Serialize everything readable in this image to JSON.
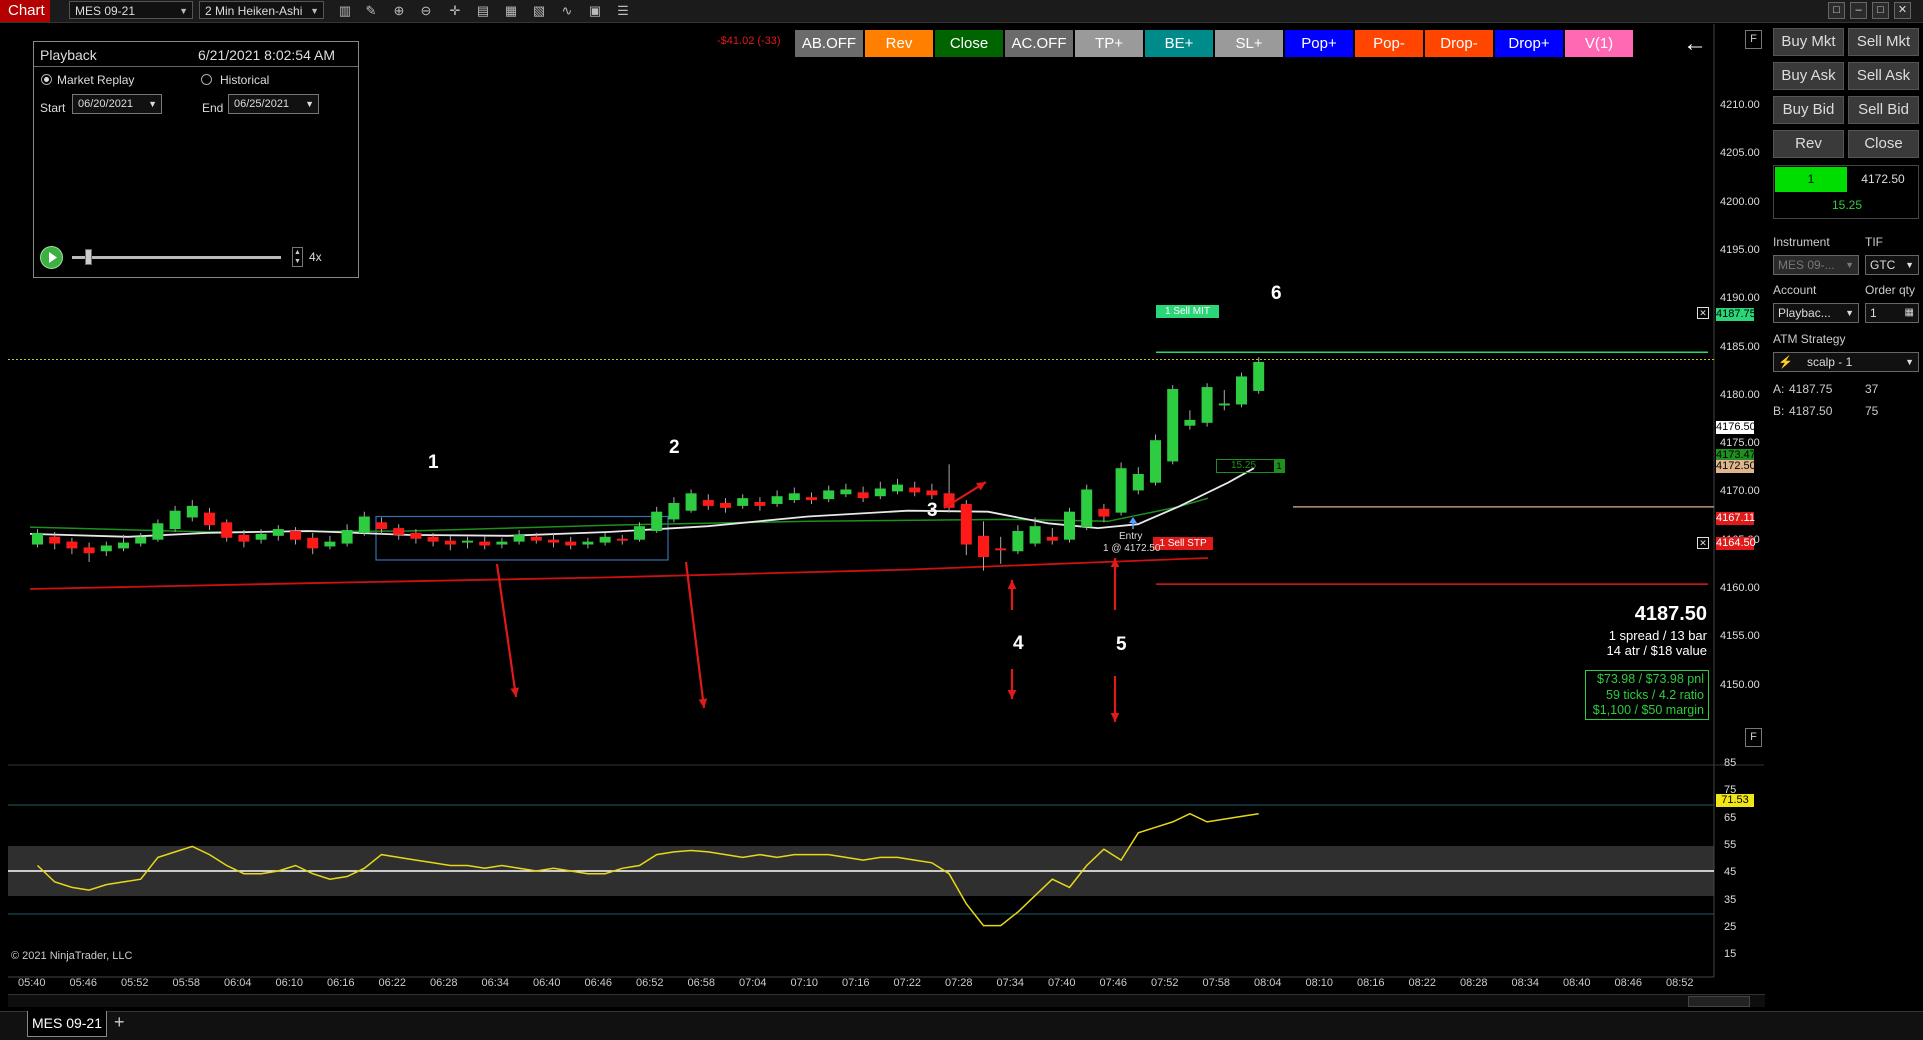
{
  "toolbar": {
    "chart_tab": "Chart",
    "instrument": "MES 09-21",
    "interval": "2 Min Heiken-Ashi",
    "icons": [
      "bars-icon",
      "draw-icon",
      "zoom-in-icon",
      "zoom-out-icon",
      "crosshair-icon",
      "properties-icon",
      "data-box-icon",
      "strategies-icon",
      "indicators-icon",
      "templates-icon",
      "menu-icon"
    ]
  },
  "pnl_text": "-$41.02 (-33)",
  "chart_buttons": [
    {
      "label": "AB.OFF",
      "color": "#6b6b6b"
    },
    {
      "label": "Rev",
      "color": "#ff7f00"
    },
    {
      "label": "Close",
      "color": "#006400"
    },
    {
      "label": "AC.OFF",
      "color": "#6b6b6b"
    },
    {
      "label": "TP+",
      "color": "#9a9a9a"
    },
    {
      "label": "BE+",
      "color": "#008b8b"
    },
    {
      "label": "SL+",
      "color": "#9a9a9a"
    },
    {
      "label": "Pop+",
      "color": "#0000ff"
    },
    {
      "label": "Pop-",
      "color": "#ff4500"
    },
    {
      "label": "Drop-",
      "color": "#ff4500"
    },
    {
      "label": "Drop+",
      "color": "#0000ff"
    },
    {
      "label": "V(1)",
      "color": "#ff69b4"
    }
  ],
  "playback": {
    "title": "Playback",
    "datetime": "6/21/2021 8:02:54 AM",
    "market_replay": "Market Replay",
    "historical": "Historical",
    "start_label": "Start",
    "start_date": "06/20/2021",
    "end_label": "End",
    "end_date": "06/25/2021",
    "speed": "4x",
    "position": 0.06
  },
  "annotations": [
    "1",
    "2",
    "3",
    "4",
    "5",
    "6"
  ],
  "markers": {
    "sell_mit": "1 Sell MIT",
    "sell_stp": "1 Sell STP",
    "entry": "Entry",
    "entry_fill": "1 @ 4172.50",
    "position_pnl": "15.25",
    "position_qty": "1"
  },
  "price_axis": [
    "4210.00",
    "4205.00",
    "4200.00",
    "4195.00",
    "4190.00",
    "4185.00",
    "4180.00",
    "4175.00",
    "4170.00",
    "4165.00",
    "4160.00",
    "4155.00",
    "4150.00"
  ],
  "price_tags": {
    "mit": "4187.75",
    "last": "4176.50",
    "ma_green": "4173.47",
    "entry": "4172.50",
    "ma_red": "4167.11",
    "stop": "4164.50"
  },
  "info": {
    "price": "4187.50",
    "line1": "1 spread / 13 bar",
    "line2": "14 atr / $18 value",
    "pnl1": "$73.98 / $73.98 pnl",
    "pnl2": "59 ticks / 4.2 ratio",
    "pnl3": "$1,100 / $50 margin"
  },
  "indicator_axis": [
    "85",
    "75",
    "65",
    "55",
    "45",
    "35",
    "25",
    "15"
  ],
  "indicator_value": "71.53",
  "copyright": "© 2021 NinjaTrader, LLC",
  "time_axis": [
    "05:40",
    "05:46",
    "05:52",
    "05:58",
    "06:04",
    "06:10",
    "06:16",
    "06:22",
    "06:28",
    "06:34",
    "06:40",
    "06:46",
    "06:52",
    "06:58",
    "07:04",
    "07:10",
    "07:16",
    "07:22",
    "07:28",
    "07:34",
    "07:40",
    "07:46",
    "07:52",
    "07:58",
    "08:04",
    "08:10",
    "08:16",
    "08:22",
    "08:28",
    "08:34",
    "08:40",
    "08:46",
    "08:52"
  ],
  "right_panel": {
    "buy_mkt": "Buy Mkt",
    "sell_mkt": "Sell Mkt",
    "buy_ask": "Buy Ask",
    "sell_ask": "Sell Ask",
    "buy_bid": "Buy Bid",
    "sell_bid": "Sell Bid",
    "rev": "Rev",
    "close": "Close",
    "position_qty": "1",
    "position_price": "4172.50",
    "position_pnl": "15.25",
    "instrument_label": "Instrument",
    "tif_label": "TIF",
    "instrument_value": "MES 09-...",
    "tif_value": "GTC",
    "account_label": "Account",
    "orderqty_label": "Order qty",
    "account_value": "Playbac...",
    "orderqty_value": "1",
    "atm_label": "ATM Strategy",
    "atm_value": "scalp - 1",
    "ask_label": "A:",
    "ask_price": "4187.75",
    "ask_size": "37",
    "bid_label": "B:",
    "bid_price": "4187.50",
    "bid_size": "75"
  },
  "bottom_tab": "MES 09-21",
  "colors": {
    "up": "#2ecc40",
    "down": "#ff1a1a",
    "ma_white": "#e8e8e8",
    "ma_green": "#1f8f1f",
    "ma_red": "#cc1111",
    "indicator": "#e6d819"
  }
}
